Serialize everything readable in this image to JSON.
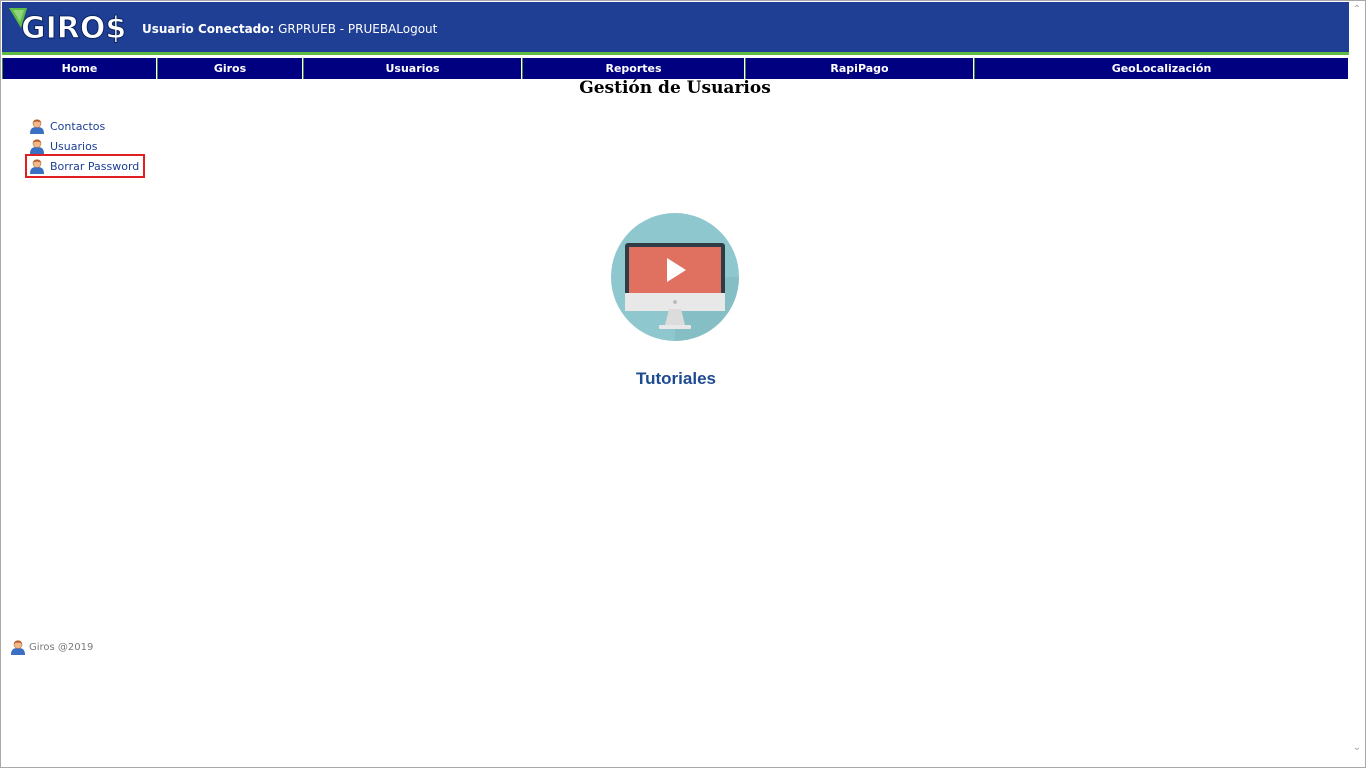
{
  "header": {
    "logo_text": "GIRO$",
    "user_label": "Usuario Conectado:",
    "user_value": "GRPRUEB - PRUEBA",
    "logout": "Logout"
  },
  "nav": {
    "items": [
      {
        "label": "Home"
      },
      {
        "label": "Giros"
      },
      {
        "label": "Usuarios"
      },
      {
        "label": "Reportes"
      },
      {
        "label": "RapiPago"
      },
      {
        "label": "GeoLocalización"
      }
    ]
  },
  "main": {
    "title": "Gestión de Usuarios",
    "menu": [
      {
        "label": "Contactos",
        "icon": "user-icon"
      },
      {
        "label": "Usuarios",
        "icon": "user-icon"
      },
      {
        "label": "Borrar Password",
        "icon": "user-icon",
        "highlighted": true
      }
    ],
    "tutorial_label": "Tutoriales",
    "tutorial_icon": "video-tutorial-icon"
  },
  "footer": {
    "text": "Giros @2019",
    "icon": "user-icon"
  },
  "colors": {
    "header_bg": "#1f3f95",
    "nav_bg": "#000080",
    "accent_green": "#5fbb46",
    "link_blue": "#1c3f94",
    "highlight_red": "#e02020",
    "tutorial_circle": "#8ec7ce",
    "tutorial_screen": "#e0705f"
  }
}
